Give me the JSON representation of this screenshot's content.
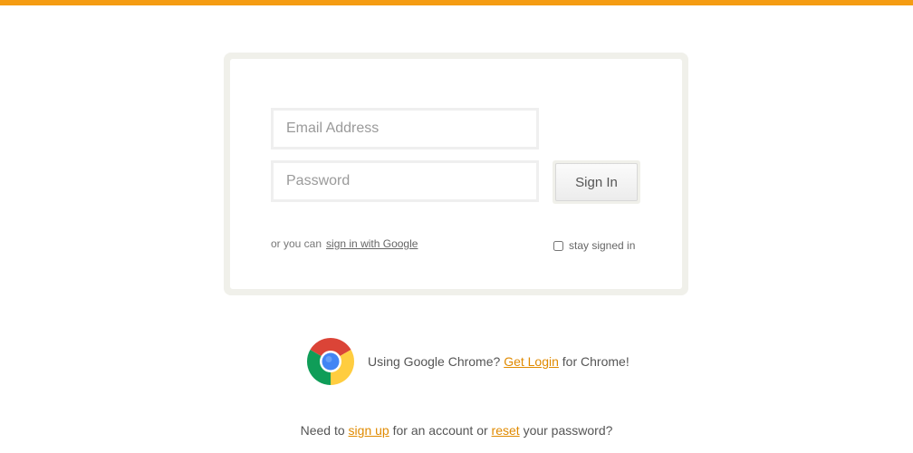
{
  "colors": {
    "accent": "#f59c12",
    "link": "#e08a00"
  },
  "login": {
    "email_placeholder": "Email Address",
    "password_placeholder": "Password",
    "signin_label": "Sign In",
    "alt_prefix": "or you can",
    "google_link": "sign in with Google",
    "stay_signed_in": "stay signed in"
  },
  "promo": {
    "icon": "chrome-icon",
    "prefix": "Using Google Chrome?",
    "link": "Get Login",
    "suffix": "for Chrome!"
  },
  "footer": {
    "prefix": "Need to",
    "signup_link": "sign up",
    "middle": "for an account or",
    "reset_link": "reset",
    "suffix": "your password?"
  }
}
